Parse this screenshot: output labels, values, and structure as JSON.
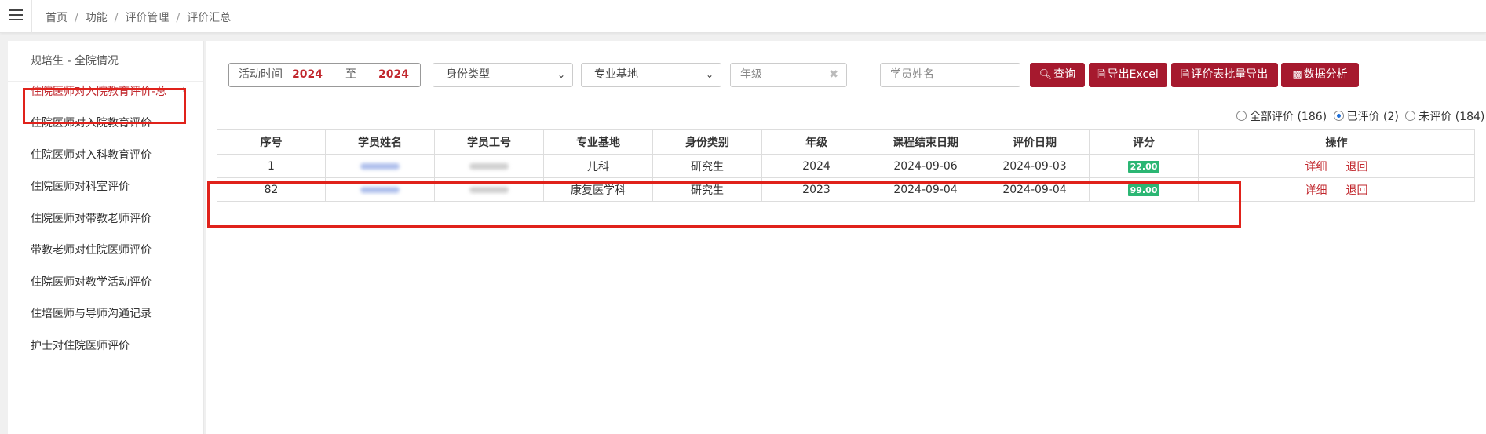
{
  "breadcrumb": [
    "首页",
    "功能",
    "评价管理",
    "评价汇总"
  ],
  "breadcrumb_sep": "/",
  "sidebar": {
    "title": "规培生 - 全院情况",
    "items": [
      {
        "label": "住院医师对入院教育评价-总",
        "active": true
      },
      {
        "label": "住院医师对入院教育评价"
      },
      {
        "label": "住院医师对入科教育评价"
      },
      {
        "label": "住院医师对科室评价"
      },
      {
        "label": "住院医师对带教老师评价"
      },
      {
        "label": "带教老师对住院医师评价"
      },
      {
        "label": "住院医师对教学活动评价"
      },
      {
        "label": "住培医师与导师沟通记录"
      },
      {
        "label": "护士对住院医师评价"
      }
    ],
    "active_chevron": "›"
  },
  "filters": {
    "date_label": "活动时间",
    "date_from": "2024",
    "date_to_label": "至",
    "date_to": "2024",
    "identity_type": "身份类型",
    "base": "专业基地",
    "grade_placeholder": "年级",
    "name_placeholder": "学员姓名"
  },
  "buttons": {
    "query": "查询",
    "export_excel": "导出Excel",
    "batch_export": "评价表批量导出",
    "analysis": "数据分析"
  },
  "radios": [
    {
      "label": "全部评价 (186)",
      "checked": false
    },
    {
      "label": "已评价 (2)",
      "checked": true
    },
    {
      "label": "未评价 (184)",
      "checked": false
    }
  ],
  "table": {
    "headers": [
      "序号",
      "学员姓名",
      "学员工号",
      "专业基地",
      "身份类别",
      "年级",
      "课程结束日期",
      "评价日期",
      "评分",
      "操作"
    ],
    "rows": [
      {
        "seq": "1",
        "base": "儿科",
        "identity": "研究生",
        "grade": "2024",
        "course_end": "2024-09-06",
        "eval_date": "2024-09-03",
        "score": "22.00"
      },
      {
        "seq": "82",
        "base": "康复医学科",
        "identity": "研究生",
        "grade": "2023",
        "course_end": "2024-09-04",
        "eval_date": "2024-09-04",
        "score": "99.00"
      }
    ],
    "actions": {
      "detail": "详细",
      "return": "退回"
    }
  },
  "colors": {
    "accent": "#a6192e",
    "highlight_box": "#e0221b",
    "score_badge": "#2bb673"
  }
}
